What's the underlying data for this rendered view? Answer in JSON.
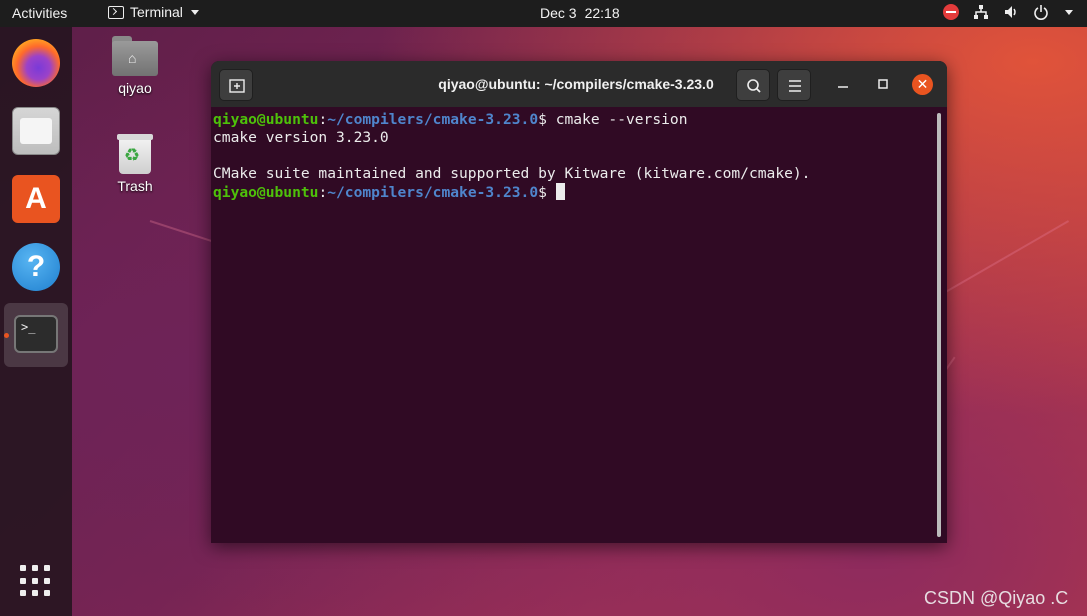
{
  "topbar": {
    "activities": "Activities",
    "app_name": "Terminal",
    "date": "Dec 3",
    "time": "22:18"
  },
  "desktop": {
    "home_label": "qiyao",
    "trash_label": "Trash"
  },
  "terminal": {
    "title": "qiyao@ubuntu: ~/compilers/cmake-3.23.0",
    "lines": [
      {
        "user": "qiyao@ubuntu",
        "path": "~/compilers/cmake-3.23.0",
        "cmd": "cmake --version"
      },
      {
        "text": "cmake version 3.23.0"
      },
      {
        "text": ""
      },
      {
        "text": "CMake suite maintained and supported by Kitware (kitware.com/cmake)."
      },
      {
        "user": "qiyao@ubuntu",
        "path": "~/compilers/cmake-3.23.0",
        "cmd": ""
      }
    ]
  },
  "dock": {
    "terminal_glyph": ">_"
  },
  "watermark": "CSDN @Qiyao  .C",
  "colors": {
    "accent": "#e95420",
    "terminal_bg": "#300a24",
    "prompt_user": "#4ec10a",
    "prompt_path": "#4f85cc"
  }
}
